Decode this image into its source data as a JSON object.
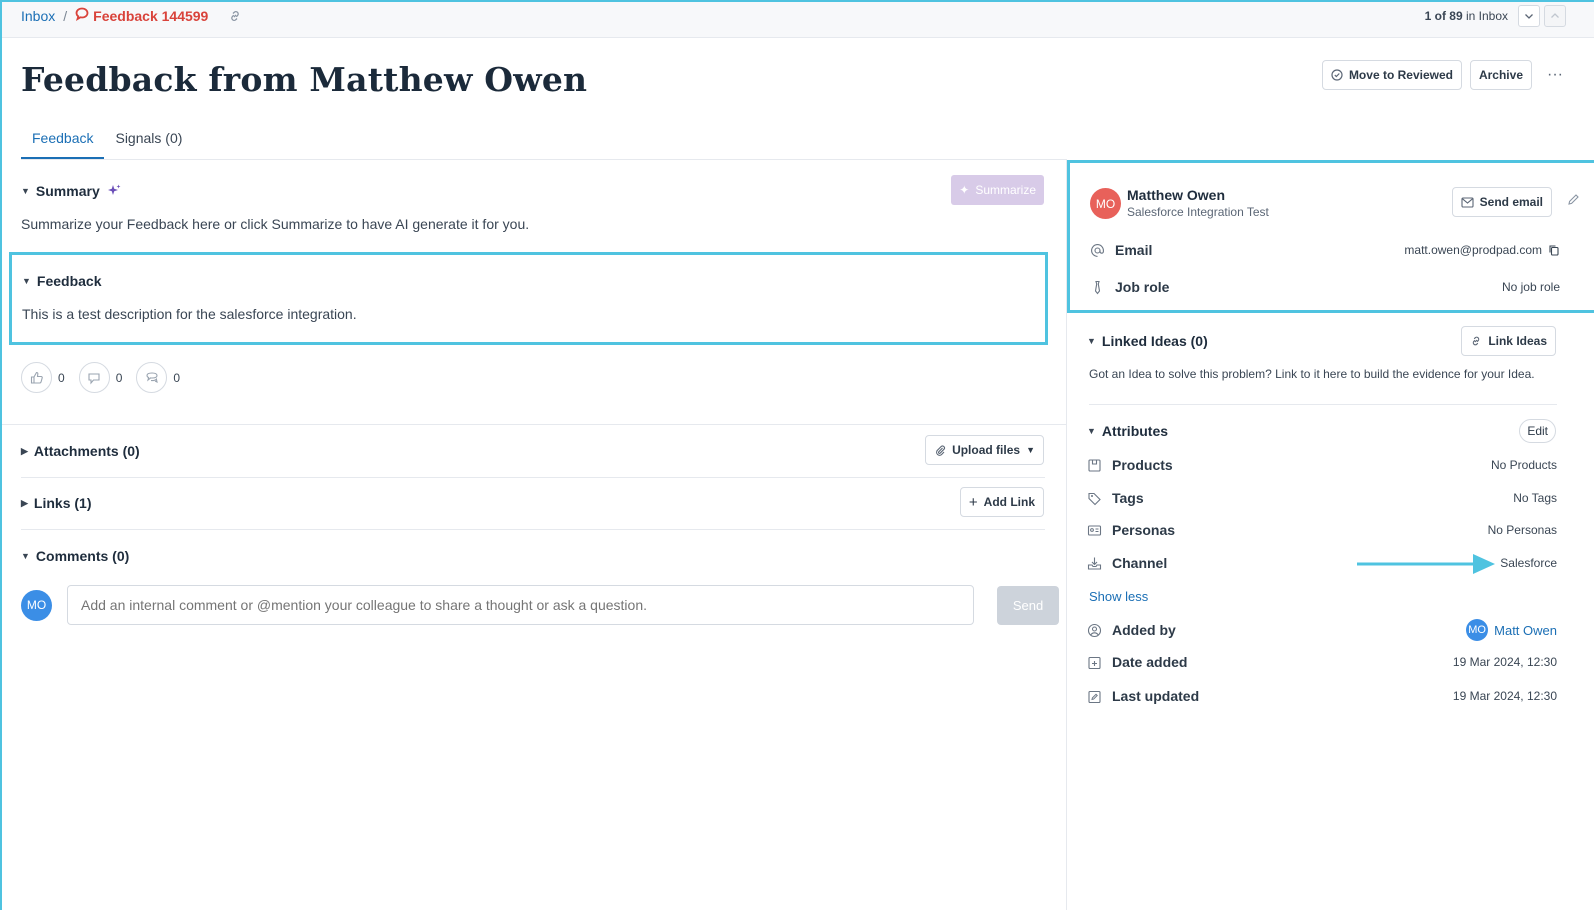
{
  "breadcrumb": {
    "inbox": "Inbox",
    "separator": "/",
    "feedback_id": "Feedback 144599"
  },
  "pager": {
    "position": "1 of 89",
    "suffix": "in Inbox"
  },
  "header": {
    "title": "Feedback from Matthew Owen",
    "move_label": "Move to Reviewed",
    "archive_label": "Archive",
    "more_label": "···"
  },
  "tabs": [
    {
      "label": "Feedback",
      "active": true
    },
    {
      "label": "Signals (0)",
      "active": false
    }
  ],
  "summary": {
    "heading": "Summary",
    "text": "Summarize your Feedback here or click Summarize to have AI generate it for you.",
    "button": "Summarize"
  },
  "feedback": {
    "heading": "Feedback",
    "text": "This is a test description for the salesforce integration."
  },
  "reactions": [
    {
      "icon": "thumbs-up-icon",
      "count": "0"
    },
    {
      "icon": "thumbs-down-icon",
      "count": "0"
    },
    {
      "icon": "chat-bubble-icon",
      "count": "0"
    }
  ],
  "attachments": {
    "heading": "Attachments (0)",
    "button": "Upload files"
  },
  "links": {
    "heading": "Links (1)",
    "button": "Add Link"
  },
  "comments": {
    "heading": "Comments (0)",
    "avatar": "MO",
    "placeholder": "Add an internal comment or @mention your colleague to share a thought or ask a question.",
    "send": "Send"
  },
  "contact": {
    "initials": "MO",
    "name": "Matthew Owen",
    "company": "Salesforce Integration Test",
    "send_email": "Send email",
    "email_label": "Email",
    "email_value": "matt.owen@prodpad.com",
    "job_label": "Job role",
    "job_value": "No job role"
  },
  "linked_ideas": {
    "heading": "Linked Ideas (0)",
    "button": "Link Ideas",
    "text": "Got an Idea to solve this problem? Link to it here to build the evidence for your Idea."
  },
  "attributes": {
    "heading": "Attributes",
    "edit": "Edit",
    "products_label": "Products",
    "products_value": "No Products",
    "tags_label": "Tags",
    "tags_value": "No Tags",
    "personas_label": "Personas",
    "personas_value": "No Personas",
    "channel_label": "Channel",
    "channel_value": "Salesforce",
    "show_less": "Show less",
    "added_by_label": "Added by",
    "added_by_initials": "MO",
    "added_by_value": "Matt Owen",
    "date_added_label": "Date added",
    "date_added_value": "19 Mar 2024, 12:30",
    "last_updated_label": "Last updated",
    "last_updated_value": "19 Mar 2024, 12:30"
  },
  "colors": {
    "accent": "#1b6fb5",
    "highlight": "#4fc3e0",
    "feedback_red": "#d9433b"
  }
}
